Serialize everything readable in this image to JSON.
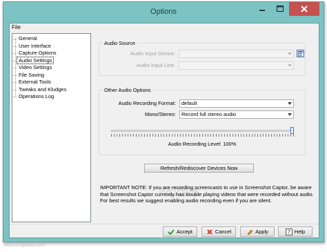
{
  "window": {
    "title": "Options"
  },
  "menu": {
    "file": "File"
  },
  "tree": {
    "items": [
      {
        "label": "General",
        "selected": false
      },
      {
        "label": "User Interface",
        "selected": false
      },
      {
        "label": "Capture Options",
        "selected": false
      },
      {
        "label": "Audio Settings",
        "selected": true
      },
      {
        "label": "Video Settings",
        "selected": false
      },
      {
        "label": "File Saving",
        "selected": false
      },
      {
        "label": "External Tools",
        "selected": false
      },
      {
        "label": "Tweaks and Kludges",
        "selected": false
      },
      {
        "label": "Operations Log",
        "selected": false
      }
    ]
  },
  "audio_source": {
    "title": "Audio Source",
    "input_device_label": "Audio Input Device:",
    "input_device_value": "",
    "input_line_label": "Audio Input Line:",
    "input_line_value": ""
  },
  "other_audio": {
    "title": "Other Audio Options",
    "format_label": "Audio Recording Format:",
    "format_value": "default",
    "mono_label": "Mono/Stereo:",
    "mono_value": "Record full stereo audio",
    "level_label": "Audio Recording Level: 100%",
    "level_fraction": 1.0
  },
  "refresh_button": "Refresh/Rediscover Devices Now",
  "note": {
    "lines": [
      "IMPORTANT NOTE: If you are recording screencasts to use in Screenshot Captor, be aware",
      "that Screenshot Captor currently has trouble playing videos that were recorded without audio.",
      "  For best results we suggest enabling audio recording even if you are silent."
    ]
  },
  "buttons": {
    "accept": "Accept",
    "cancel": "Cancel",
    "apply": "Apply",
    "help": "Help"
  },
  "watermark": {
    "mid": "SOFTPEDIA",
    "small": "www.softpedia.com",
    "corner": "www.softpedia.com"
  }
}
